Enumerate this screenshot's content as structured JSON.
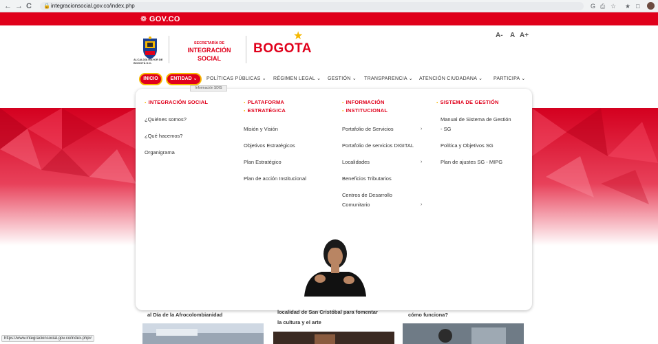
{
  "browser": {
    "back_glyph": "←",
    "forward_glyph": "→",
    "reload_glyph": "C",
    "url": "integracionsocial.gov.co/index.php",
    "status_url": "https://www.integracionsocial.gov.co/index.php#",
    "extension_icons": [
      "G",
      "⎙",
      "☆",
      "★",
      "□"
    ]
  },
  "gov_bar": {
    "logo_text": "GOV.CO"
  },
  "header": {
    "escudo_label": "ALCALDÍA MAYOR DE BOGOTÁ D.C.",
    "sdis_line1": "SECRETARÍA DE",
    "sdis_line2": "INTEGRACIÓN SOCIAL",
    "bogota_text": "BOGOTA",
    "font_controls": [
      "A-",
      "A",
      "A+"
    ]
  },
  "nav": {
    "inicio": "INICIO",
    "entidad": "ENTIDAD ⌄",
    "tooltip": "Información SDIS",
    "items": [
      "POLÍTICAS PÚBLICAS ⌄",
      "RÉGIMEN LEGAL ⌄",
      "GESTIÓN ⌄",
      "TRANSPARENCIA ⌄",
      "ATENCIÓN CIUDADANA ⌄",
      "PARTICIPA ⌄"
    ]
  },
  "mega_menu": {
    "columns": [
      {
        "title": "INTEGRACIÓN SOCIAL",
        "title2": "",
        "links": [
          "¿Quiénes somos?",
          "¿Qué hacemos?",
          "Organigrama"
        ]
      },
      {
        "title": "PLATAFORMA",
        "title2": "ESTRATÉGICA",
        "links": [
          "Misión y Visión",
          "Objetivos Estratégicos",
          "Plan Estratégico",
          "Plan de acción Institucional"
        ]
      },
      {
        "title": "INFORMACIÓN",
        "title2": "INSTITUCIONAL",
        "links": [
          "Portafolio de Servicios",
          "Portafolio de servicios DIGITAL",
          "Localidades",
          "Beneficios Tributarios",
          "Centros de Desarrollo",
          "Comunitario"
        ]
      },
      {
        "title": "SISTEMA DE GESTIÓN",
        "title2": "",
        "links": [
          "Manual de Sistema de Gestión",
          "- SG",
          "Política y Objetivos SG",
          "Plan de ajustes SG - MIPG"
        ]
      }
    ],
    "chevron": "›"
  },
  "cards": [
    {
      "line1": "al Día de la Afrocolombianidad",
      "line2": ""
    },
    {
      "line1": "localidad de San Cristóbal para fomentar",
      "line2": "la cultura y el arte"
    },
    {
      "line1": "cómo funciona?",
      "line2": ""
    }
  ],
  "colors": {
    "brand_red": "#e0001b",
    "accent_yellow": "#f6b800"
  }
}
